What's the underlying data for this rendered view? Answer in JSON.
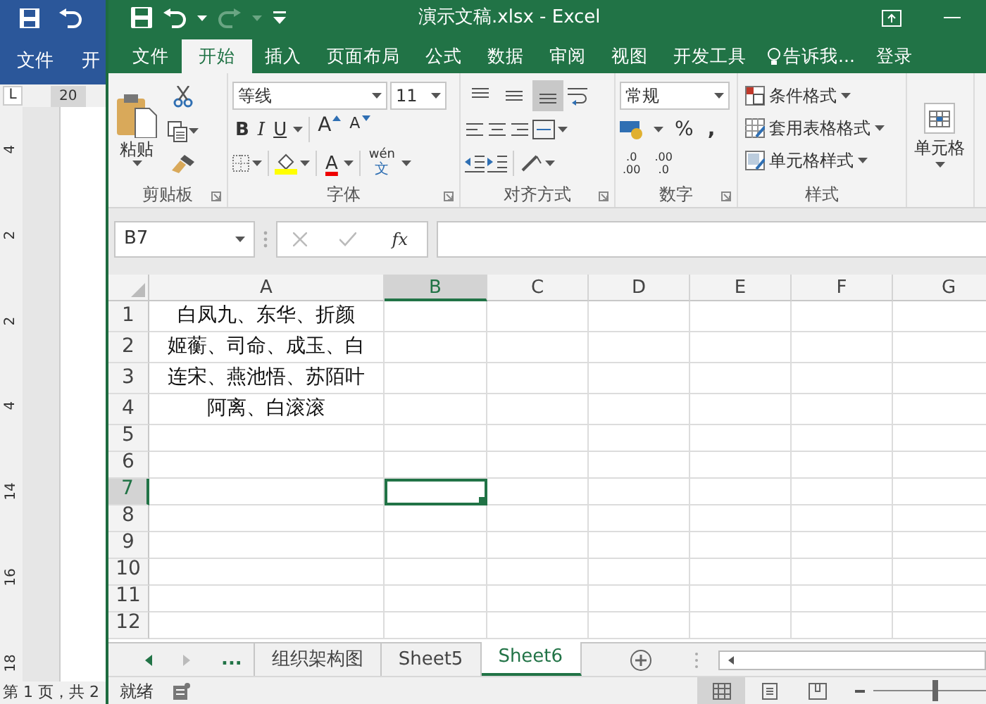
{
  "background_window": {
    "tabs": [
      "文件",
      "开"
    ],
    "tab_stop": "L",
    "ruler_number": "20",
    "vertical_ruler": [
      "4",
      "2",
      "2",
      "4",
      "14",
      "16",
      "18"
    ],
    "status": "第 1 页，共 2"
  },
  "title_bar": {
    "title": "演示文稿.xlsx - Excel"
  },
  "ribbon_tabs": [
    {
      "label": "文件",
      "selected": false
    },
    {
      "label": "开始",
      "selected": true
    },
    {
      "label": "插入",
      "selected": false
    },
    {
      "label": "页面布局",
      "selected": false
    },
    {
      "label": "公式",
      "selected": false
    },
    {
      "label": "数据",
      "selected": false
    },
    {
      "label": "审阅",
      "selected": false
    },
    {
      "label": "视图",
      "selected": false
    },
    {
      "label": "开发工具",
      "selected": false
    }
  ],
  "tell_me": "告诉我...",
  "sign_in": "登录",
  "ribbon": {
    "clipboard": {
      "paste": "粘贴",
      "label": "剪贴板"
    },
    "font": {
      "name": "等线",
      "size": "11",
      "bold": "B",
      "italic": "I",
      "underline": "U",
      "grow": "A",
      "shrink": "A",
      "font_color": "A",
      "phonetic_top": "wén",
      "phonetic_bottom": "文",
      "label": "字体"
    },
    "alignment": {
      "vertical": [
        {
          "kind": "top",
          "selected": false
        },
        {
          "kind": "middle",
          "selected": false
        },
        {
          "kind": "bottom",
          "selected": true
        }
      ],
      "label": "对齐方式"
    },
    "number": {
      "format": "常规",
      "percent": "%",
      "comma": ",",
      "increase_decimal": [
        ".0",
        ".00"
      ],
      "decrease_decimal": [
        ".00",
        ".0"
      ],
      "label": "数字"
    },
    "styles": {
      "items": [
        "条件格式",
        "套用表格格式",
        "单元格样式"
      ],
      "label": "样式"
    },
    "cells": {
      "label": "单元格"
    }
  },
  "formula_bar": {
    "name_box": "B7",
    "fx": "fx"
  },
  "sheet": {
    "columns": [
      {
        "label": "A",
        "selected": false
      },
      {
        "label": "B",
        "selected": true
      },
      {
        "label": "C",
        "selected": false
      },
      {
        "label": "D",
        "selected": false
      },
      {
        "label": "E",
        "selected": false
      },
      {
        "label": "F",
        "selected": false
      },
      {
        "label": "G",
        "selected": false
      }
    ],
    "rows": [
      {
        "label": "1",
        "selected": false,
        "value": "白凤九、东华、折颜"
      },
      {
        "label": "2",
        "selected": false,
        "value": "姬蘅、司命、成玉、白"
      },
      {
        "label": "3",
        "selected": false,
        "value": "连宋、燕池悟、苏陌叶"
      },
      {
        "label": "4",
        "selected": false,
        "value": "阿离、白滚滚"
      },
      {
        "label": "5",
        "selected": false
      },
      {
        "label": "6",
        "selected": false
      },
      {
        "label": "7",
        "selected": true
      },
      {
        "label": "8",
        "selected": false
      },
      {
        "label": "9",
        "selected": false
      },
      {
        "label": "10",
        "selected": false
      },
      {
        "label": "11",
        "selected": false
      },
      {
        "label": "12",
        "selected": false
      }
    ]
  },
  "sheet_tabs": {
    "more": "...",
    "tabs": [
      {
        "label": "组织架构图",
        "selected": false
      },
      {
        "label": "Sheet5",
        "selected": false
      },
      {
        "label": "Sheet6",
        "selected": true
      }
    ]
  },
  "status_bar": {
    "status": "就绪",
    "views": [
      {
        "kind": "normal",
        "selected": true
      },
      {
        "kind": "page_layout",
        "selected": false
      },
      {
        "kind": "page_break",
        "selected": false
      }
    ],
    "zoom": {
      "level": 0.55
    }
  }
}
